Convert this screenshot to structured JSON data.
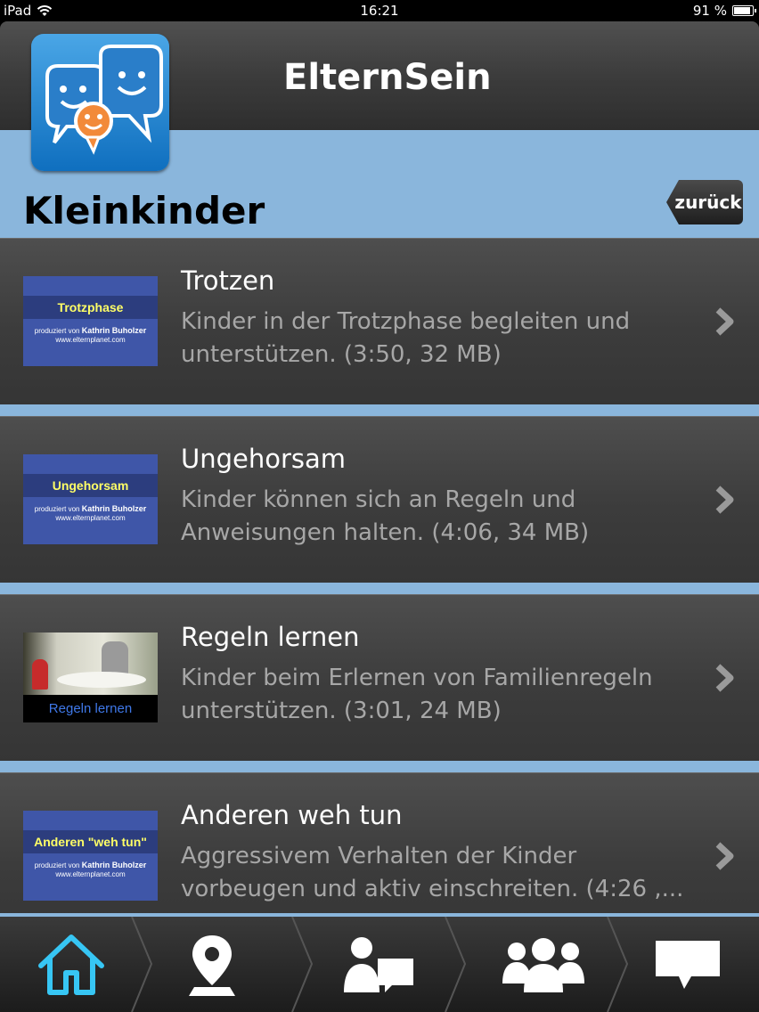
{
  "status_bar": {
    "device": "iPad",
    "time": "16:21",
    "battery": "91 %",
    "battery_level": 0.91
  },
  "header": {
    "app_title": "ElternSein",
    "logo_icon": "speech-bubbles-faces-logo"
  },
  "section": {
    "title": "Kleinkinder",
    "back_label": "zurück"
  },
  "items": [
    {
      "title": "Trotzen",
      "description": "Kinder in der Trotzphase begleiten und unterstützen. (3:50, 32 MB)",
      "thumb_title": "Trotzphase",
      "thumb_credit_small": "produziert von",
      "thumb_credit_name": "Kathrin Buholzer",
      "thumb_url": "www.elternplanet.com"
    },
    {
      "title": "Ungehorsam",
      "description": "Kinder können sich an Regeln und Anweisungen halten. (4:06, 34 MB)",
      "thumb_title": "Ungehorsam",
      "thumb_credit_small": "produziert von",
      "thumb_credit_name": "Kathrin Buholzer",
      "thumb_url": "www.elternplanet.com"
    },
    {
      "title": "Regeln lernen",
      "description": "Kinder beim Erlernen von Familienregeln unterstützen. (3:01, 24 MB)",
      "thumb_caption": "Regeln lernen"
    },
    {
      "title": "Anderen weh tun",
      "description": "Aggressivem Verhalten der Kinder vorbeugen und aktiv einschreiten. (4:26 ,...",
      "thumb_title": "Anderen \"weh tun\"",
      "thumb_credit_small": "produziert von",
      "thumb_credit_name": "Kathrin Buholzer",
      "thumb_url": "www.elternplanet.com"
    }
  ],
  "tabs": [
    {
      "icon": "home-icon",
      "active": true
    },
    {
      "icon": "map-pin-icon",
      "active": false
    },
    {
      "icon": "counselor-chat-icon",
      "active": false
    },
    {
      "icon": "group-icon",
      "active": false
    },
    {
      "icon": "speech-bubble-icon",
      "active": false
    }
  ],
  "colors": {
    "accent_blue": "#8ab6dc",
    "active_tab": "#37c6f4"
  }
}
